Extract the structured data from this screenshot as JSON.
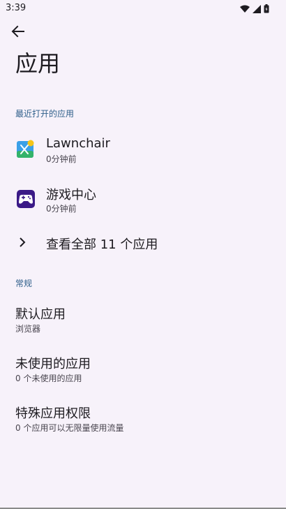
{
  "status_bar": {
    "time": "3:39",
    "icons": [
      "wifi-icon",
      "cellular-icon",
      "battery-icon"
    ]
  },
  "header": {
    "back_icon": "arrow-back-icon",
    "title": "应用"
  },
  "recent": {
    "section_label": "最近打开的应用",
    "apps": [
      {
        "name": "Lawnchair",
        "subtitle": "0分钟前",
        "icon": "lawnchair-icon"
      },
      {
        "name": "游戏中心",
        "subtitle": "0分钟前",
        "icon": "game-center-icon"
      }
    ],
    "see_all_label": "查看全部 11 个应用"
  },
  "general": {
    "section_label": "常规",
    "items": [
      {
        "title": "默认应用",
        "subtitle": "浏览器"
      },
      {
        "title": "未使用的应用",
        "subtitle": "0 个未使用的应用"
      },
      {
        "title": "特殊应用权限",
        "subtitle": "0 个应用可以无限量使用流量"
      }
    ]
  },
  "colors": {
    "background": "#f7f2fa",
    "section_header": "#2f5f8a",
    "text_primary": "#1d1b20",
    "text_secondary": "#49454f"
  }
}
